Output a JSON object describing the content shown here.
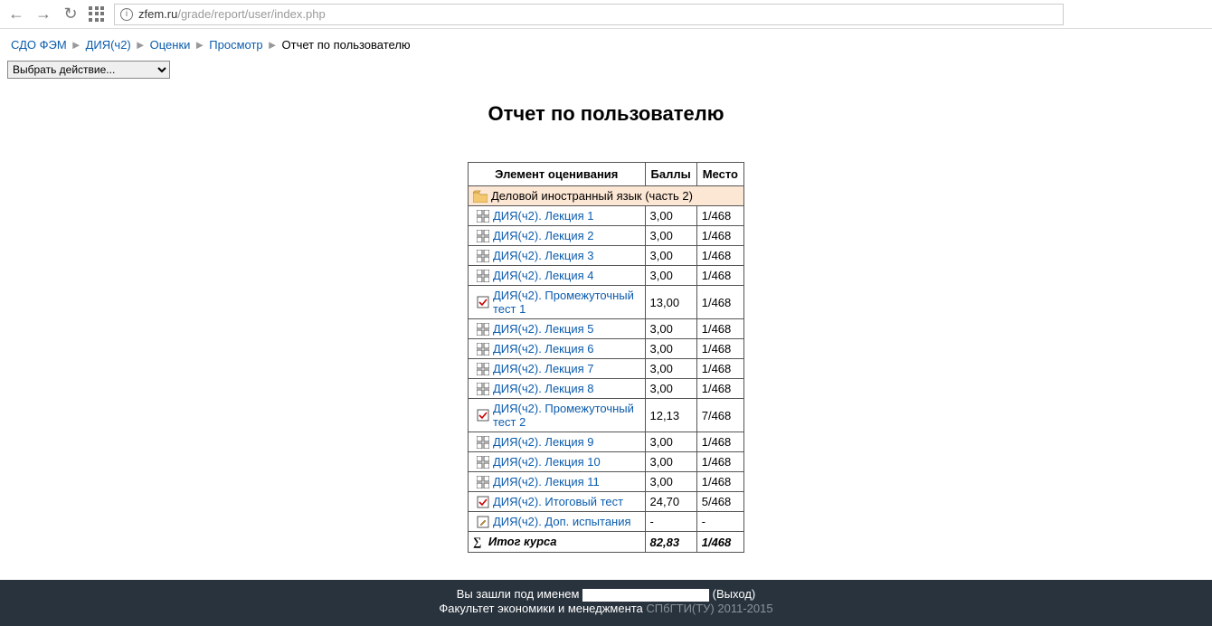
{
  "url": {
    "host": "zfem.ru",
    "path": "/grade/report/user/index.php"
  },
  "breadcrumb": [
    {
      "label": "СДО ФЭМ",
      "link": true
    },
    {
      "label": "ДИЯ(ч2)",
      "link": true
    },
    {
      "label": "Оценки",
      "link": true
    },
    {
      "label": "Просмотр",
      "link": true
    },
    {
      "label": "Отчет по пользователю",
      "link": false
    }
  ],
  "select_label": "Выбрать действие...",
  "page_title": "Отчет по пользователю",
  "table": {
    "headers": {
      "item": "Элемент оценивания",
      "score": "Баллы",
      "place": "Место"
    },
    "folder": "Деловой иностранный язык (часть 2)",
    "rows": [
      {
        "type": "lesson",
        "label": "ДИЯ(ч2). Лекция 1",
        "score": "3,00",
        "place": "1/468"
      },
      {
        "type": "lesson",
        "label": "ДИЯ(ч2). Лекция 2",
        "score": "3,00",
        "place": "1/468"
      },
      {
        "type": "lesson",
        "label": "ДИЯ(ч2). Лекция 3",
        "score": "3,00",
        "place": "1/468"
      },
      {
        "type": "lesson",
        "label": "ДИЯ(ч2). Лекция 4",
        "score": "3,00",
        "place": "1/468"
      },
      {
        "type": "test",
        "label": "ДИЯ(ч2). Промежуточный тест 1",
        "score": "13,00",
        "place": "1/468"
      },
      {
        "type": "lesson",
        "label": "ДИЯ(ч2). Лекция 5",
        "score": "3,00",
        "place": "1/468"
      },
      {
        "type": "lesson",
        "label": "ДИЯ(ч2). Лекция 6",
        "score": "3,00",
        "place": "1/468"
      },
      {
        "type": "lesson",
        "label": "ДИЯ(ч2). Лекция 7",
        "score": "3,00",
        "place": "1/468"
      },
      {
        "type": "lesson",
        "label": "ДИЯ(ч2). Лекция 8",
        "score": "3,00",
        "place": "1/468"
      },
      {
        "type": "test",
        "label": "ДИЯ(ч2). Промежуточный тест 2",
        "score": "12,13",
        "place": "7/468"
      },
      {
        "type": "lesson",
        "label": "ДИЯ(ч2). Лекция 9",
        "score": "3,00",
        "place": "1/468"
      },
      {
        "type": "lesson",
        "label": "ДИЯ(ч2). Лекция 10",
        "score": "3,00",
        "place": "1/468"
      },
      {
        "type": "lesson",
        "label": "ДИЯ(ч2). Лекция 11",
        "score": "3,00",
        "place": "1/468"
      },
      {
        "type": "test",
        "label": "ДИЯ(ч2). Итоговый тест",
        "score": "24,70",
        "place": "5/468"
      },
      {
        "type": "pencil",
        "label": "ДИЯ(ч2). Доп. испытания",
        "score": "-",
        "place": "-"
      }
    ],
    "total": {
      "label": "Итог курса",
      "score": "82,83",
      "place": "1/468"
    }
  },
  "footer": {
    "logged_prefix": "Вы зашли под именем ",
    "logout": "Выход",
    "faculty": "Факультет экономики и менеджмента ",
    "org": "СПбГТИ(ТУ) 2011-2015"
  }
}
